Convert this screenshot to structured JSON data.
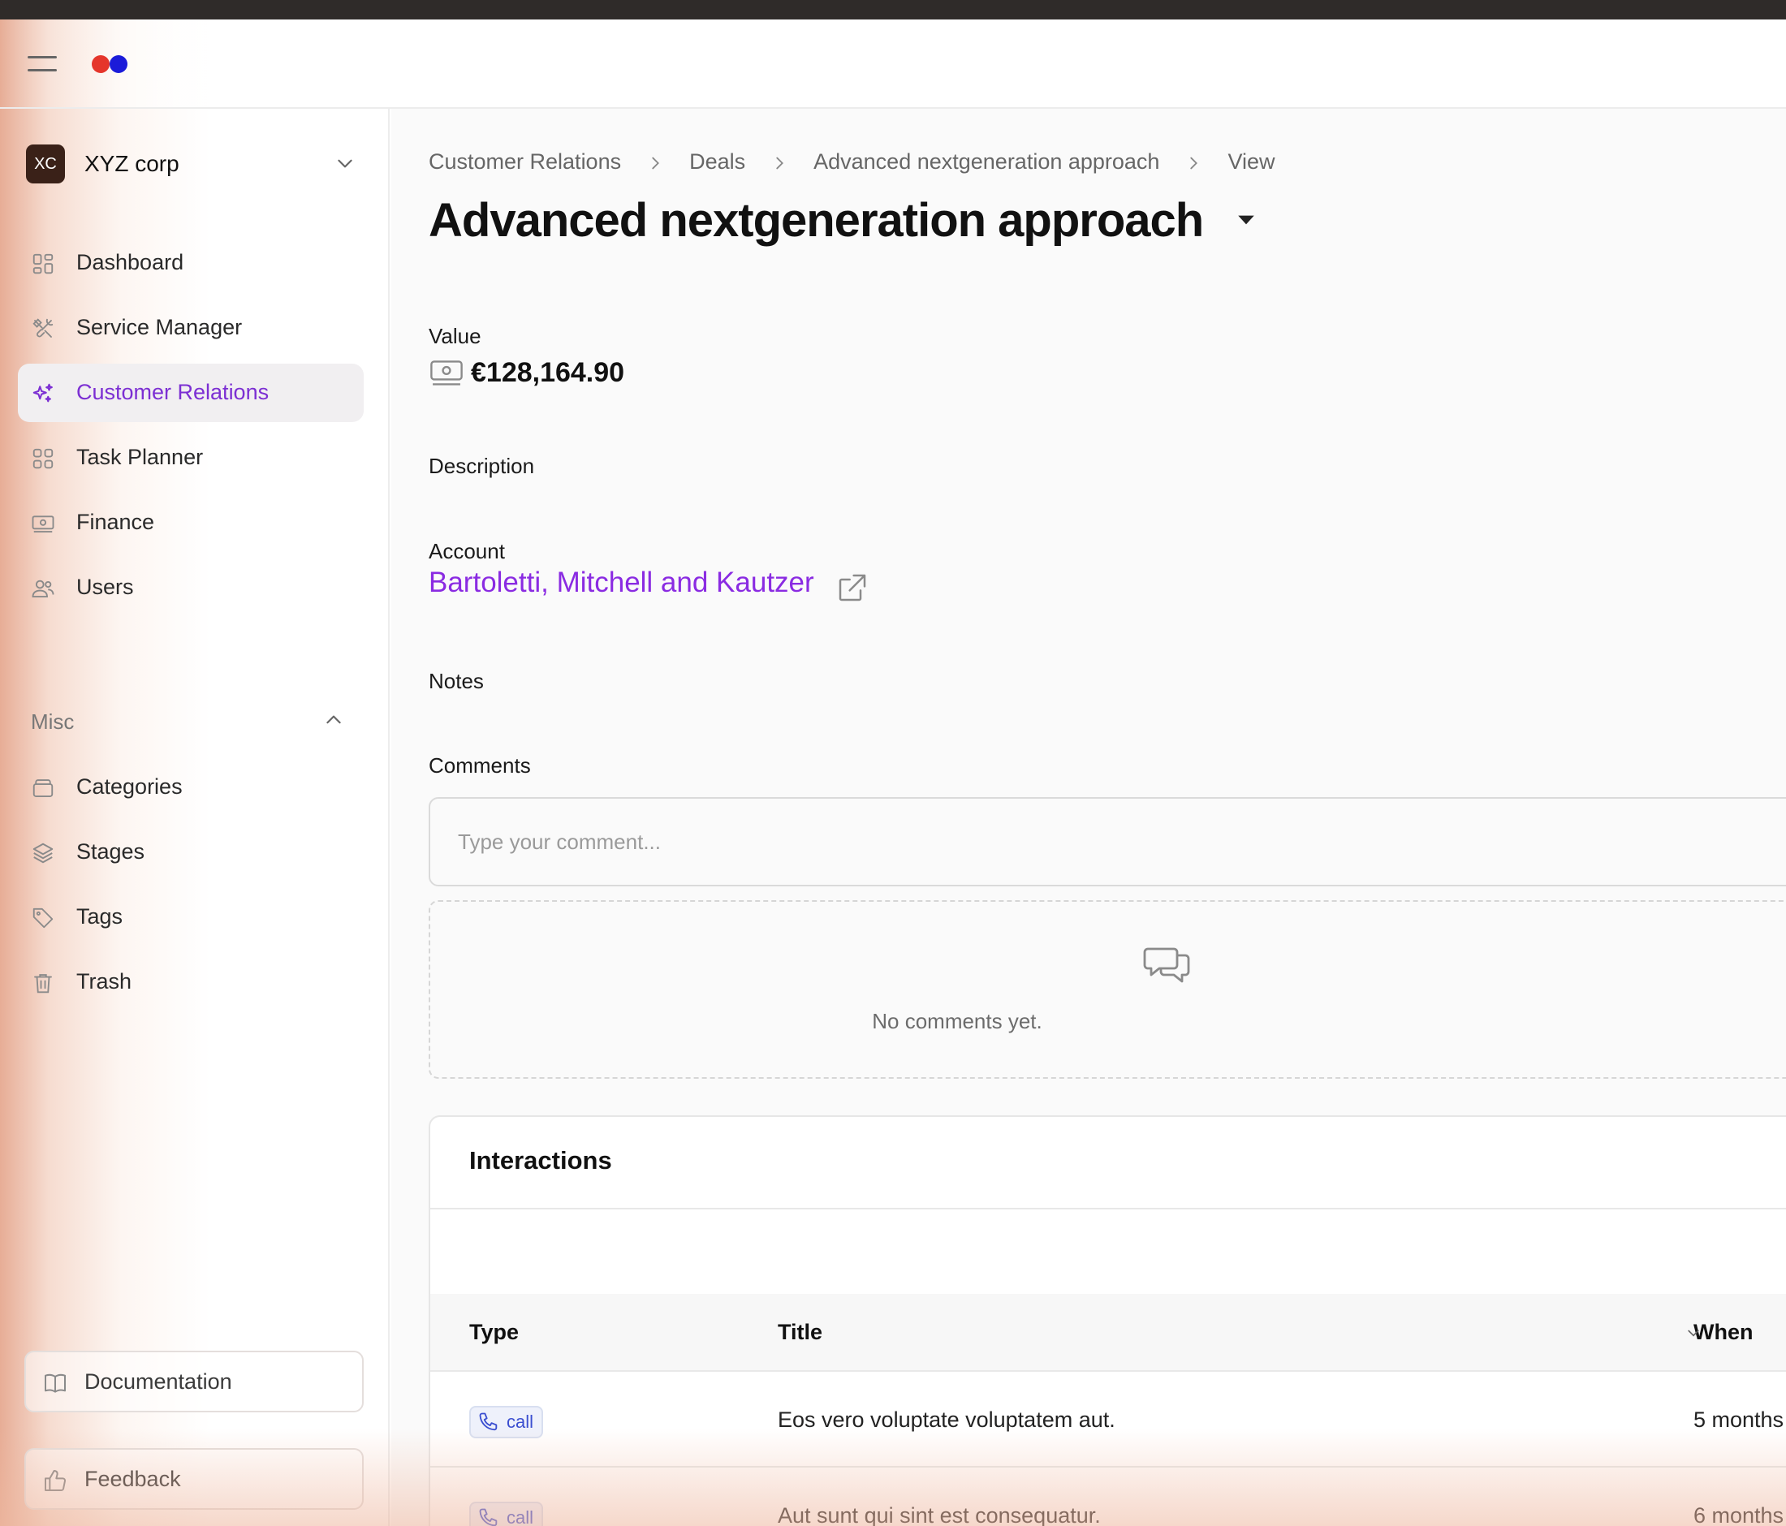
{
  "app": {
    "logo_colors": [
      "#e5352b",
      "#1b1bd9"
    ]
  },
  "sidebar": {
    "org": {
      "initials": "XC",
      "name": "XYZ corp"
    },
    "items": [
      {
        "label": "Dashboard",
        "icon": "grid-icon"
      },
      {
        "label": "Service Manager",
        "icon": "tools-icon"
      },
      {
        "label": "Customer Relations",
        "icon": "sparkles-icon",
        "active": true
      },
      {
        "label": "Task Planner",
        "icon": "squares-icon"
      },
      {
        "label": "Finance",
        "icon": "banknote-icon"
      },
      {
        "label": "Users",
        "icon": "users-icon"
      }
    ],
    "misc_label": "Misc",
    "misc_items": [
      {
        "label": "Categories",
        "icon": "box-icon"
      },
      {
        "label": "Stages",
        "icon": "layers-icon"
      },
      {
        "label": "Tags",
        "icon": "tag-icon"
      },
      {
        "label": "Trash",
        "icon": "trash-icon"
      }
    ],
    "documentation_label": "Documentation",
    "feedback_label": "Feedback"
  },
  "breadcrumb": [
    "Customer Relations",
    "Deals",
    "Advanced nextgeneration approach",
    "View"
  ],
  "page_title": "Advanced nextgeneration approach",
  "fields": {
    "value_label": "Value",
    "value": "€128,164.90",
    "description_label": "Description",
    "account_label": "Account",
    "account_name": "Bartoletti, Mitchell and Kautzer",
    "notes_label": "Notes",
    "comments_label": "Comments"
  },
  "comments": {
    "placeholder": "Type your comment...",
    "empty_text": "No comments yet."
  },
  "interactions": {
    "title": "Interactions",
    "columns": [
      "Type",
      "Title",
      "When"
    ],
    "rows": [
      {
        "type": "call",
        "title": "Eos vero voluptate voluptatem aut.",
        "when": "5 months"
      },
      {
        "type": "call",
        "title": "Aut sunt qui sint est consequatur.",
        "when": "6 months"
      }
    ]
  },
  "colors": {
    "accent": "#7c2fd3",
    "link": "#8a2be2",
    "badge_text": "#3b4fd0"
  }
}
